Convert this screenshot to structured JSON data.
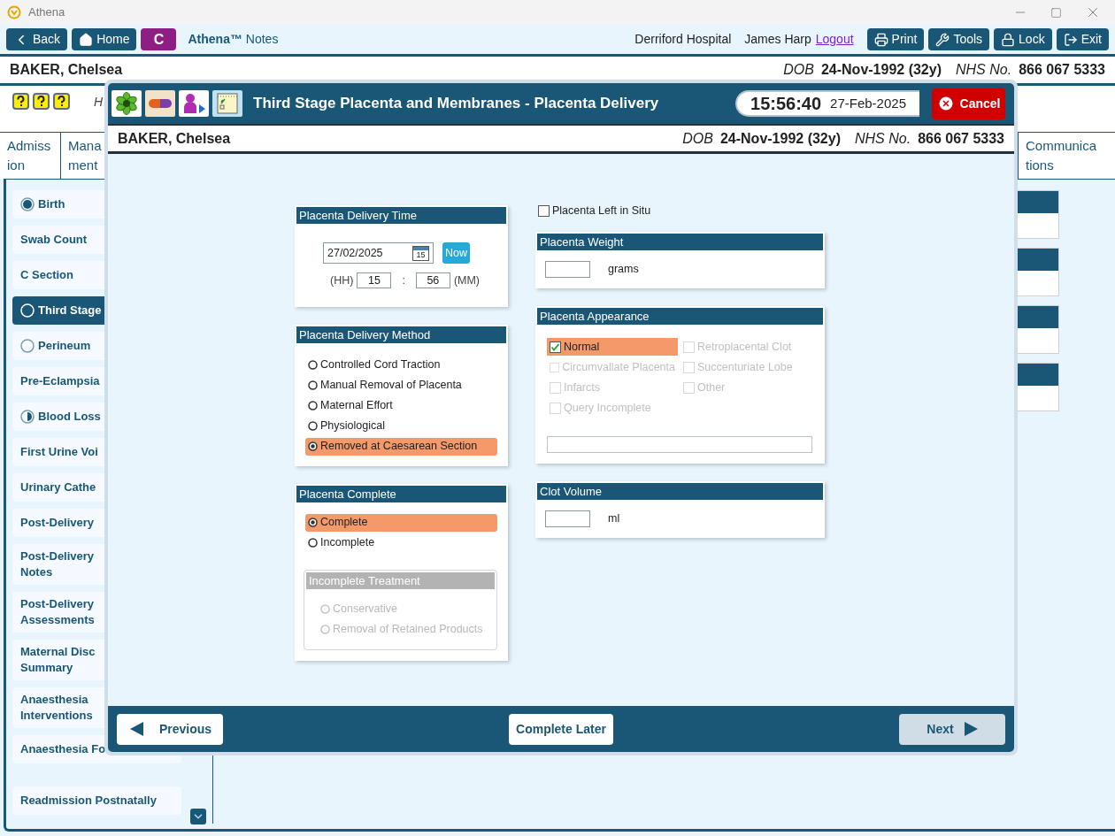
{
  "window": {
    "title": "Athena"
  },
  "toolbar": {
    "back": "Back",
    "home": "Home",
    "patient_initial": "C",
    "app_name": "**Athena™** Notes",
    "hospital": "Derriford Hospital",
    "user": "James Harp",
    "logout": "Logout",
    "buttons": [
      "Print",
      "Tools",
      "Lock",
      "Exit"
    ]
  },
  "patient": {
    "name": "BAKER, Chelsea",
    "dob_label": "DOB",
    "dob": "24-Nov-1992 (32y)",
    "nhs_label": "NHS No.",
    "nhs": "866 067 5333"
  },
  "hint_text": "H",
  "tabs": [
    {
      "lines": [
        "Admiss",
        "ion"
      ],
      "selected": false
    },
    {
      "lines": [
        "Mana",
        "ment"
      ],
      "selected": false
    },
    {
      "lines": [
        "Communica",
        "tions"
      ],
      "selected": false
    }
  ],
  "sidebar": {
    "items": [
      {
        "label": "Birth",
        "selected": false,
        "kind": "full"
      },
      {
        "label": "Swab Count",
        "selected": false,
        "kind": "plain"
      },
      {
        "label": "C Section",
        "selected": false,
        "kind": "plain"
      },
      {
        "label": "Third Stage",
        "selected": true,
        "kind": "empty"
      },
      {
        "label": "Perineum",
        "selected": false,
        "kind": "empty"
      },
      {
        "label": "Pre-Eclampsia",
        "selected": false,
        "kind": "plain"
      },
      {
        "label": "Blood Loss",
        "selected": false,
        "kind": "half"
      },
      {
        "label": "First Urine Voi",
        "selected": false,
        "kind": "plain"
      },
      {
        "label": "Urinary Cathe",
        "selected": false,
        "kind": "plain"
      },
      {
        "label": "Post-Delivery",
        "selected": false,
        "kind": "plain"
      },
      {
        "label": "Post-Delivery Notes",
        "selected": false,
        "kind": "plain"
      },
      {
        "label": "Post-Delivery Assessments",
        "selected": false,
        "kind": "plain"
      },
      {
        "label": "Maternal Disc Summary",
        "selected": false,
        "kind": "plain"
      },
      {
        "label": "Anaesthesia Interventions",
        "selected": false,
        "kind": "plain"
      },
      {
        "label": "Anaesthesia Fo",
        "selected": false,
        "kind": "plain"
      }
    ],
    "footer_item": {
      "label": "Readmission Postnatally",
      "selected": false
    }
  },
  "dialog": {
    "title": "Third Stage Placenta and Membranes - Placenta Delivery",
    "time": "15:56:40",
    "date": "27-Feb-2025",
    "cancel": "Cancel",
    "patient": {
      "name": "BAKER, Chelsea",
      "dob_label": "DOB",
      "dob": "24-Nov-1992 (32y)",
      "nhs_label": "NHS No.",
      "nhs": "866 067 5333"
    },
    "delivery_time": {
      "title": "Placenta Delivery Time",
      "date": "27/02/2025",
      "calendar_day": "15",
      "now": "Now",
      "hh_label": "(HH)",
      "hh": "15",
      "separator": ":",
      "mm": "56",
      "mm_label": "(MM)"
    },
    "delivery_method": {
      "title": "Placenta Delivery Method",
      "options": [
        {
          "label": "Controlled Cord Traction",
          "selected": false,
          "disabled": false
        },
        {
          "label": "Manual Removal of Placenta",
          "selected": false,
          "disabled": false
        },
        {
          "label": "Maternal Effort",
          "selected": false,
          "disabled": false
        },
        {
          "label": "Physiological",
          "selected": false,
          "disabled": false
        },
        {
          "label": "Removed at Caesarean Section",
          "selected": true,
          "disabled": false
        }
      ]
    },
    "complete": {
      "title": "Placenta Complete",
      "options": [
        {
          "label": "Complete",
          "selected": true,
          "disabled": false
        },
        {
          "label": "Incomplete",
          "selected": false,
          "disabled": false
        }
      ],
      "treatment": {
        "title": "Incomplete Treatment",
        "disabled": true,
        "options": [
          {
            "label": "Conservative",
            "selected": false,
            "disabled": true
          },
          {
            "label": "Removal of Retained Products",
            "selected": false,
            "disabled": true
          }
        ]
      }
    },
    "left_in_situ": {
      "label": "Placenta Left in Situ",
      "checked": false
    },
    "weight": {
      "title": "Placenta Weight",
      "unit": "grams"
    },
    "appearance": {
      "title": "Placenta Appearance",
      "options": [
        {
          "label": "Normal",
          "checked": true,
          "disabled": false
        },
        {
          "label": "Retroplacental Clot",
          "checked": false,
          "disabled": true
        },
        {
          "label": "Circumvallate Placenta",
          "checked": false,
          "disabled": true
        },
        {
          "label": "Succenturiate Lobe",
          "checked": false,
          "disabled": true
        },
        {
          "label": "Infarcts",
          "checked": false,
          "disabled": true
        },
        {
          "label": "Other",
          "checked": false,
          "disabled": true
        },
        {
          "label": "Query Incomplete",
          "checked": false,
          "disabled": true
        }
      ]
    },
    "clot_volume": {
      "title": "Clot Volume",
      "unit": "ml"
    },
    "footer": {
      "previous": "Previous",
      "complete_later": "Complete Later",
      "next": "Next",
      "next_disabled": true
    }
  }
}
